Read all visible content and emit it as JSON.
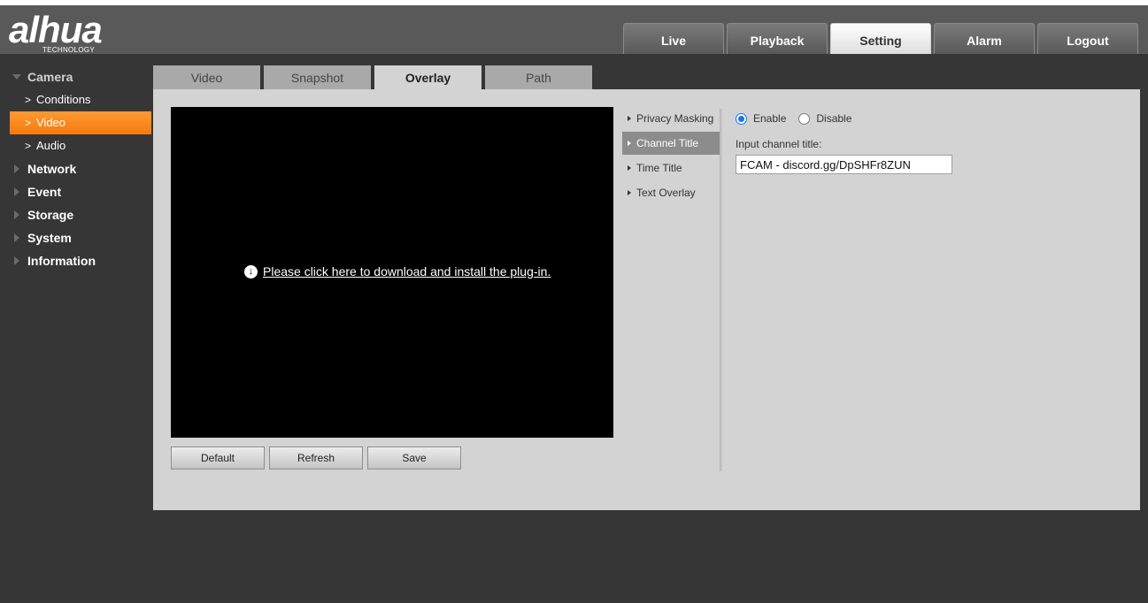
{
  "logo": {
    "main": "alhua",
    "sub": "TECHNOLOGY"
  },
  "topnav": [
    {
      "label": "Live"
    },
    {
      "label": "Playback"
    },
    {
      "label": "Setting"
    },
    {
      "label": "Alarm"
    },
    {
      "label": "Logout"
    }
  ],
  "sidebar": {
    "camera": "Camera",
    "conditions": "Conditions",
    "video": "Video",
    "audio": "Audio",
    "network": "Network",
    "event": "Event",
    "storage": "Storage",
    "system": "System",
    "information": "Information"
  },
  "tabs": [
    {
      "label": "Video"
    },
    {
      "label": "Snapshot"
    },
    {
      "label": "Overlay"
    },
    {
      "label": "Path"
    }
  ],
  "player": {
    "plugin_text": "Please click here to download and install the plug-in."
  },
  "buttons": {
    "default": "Default",
    "refresh": "Refresh",
    "save": "Save"
  },
  "submenu": [
    {
      "label": "Privacy Masking"
    },
    {
      "label": "Channel Title"
    },
    {
      "label": "Time Title"
    },
    {
      "label": "Text Overlay"
    }
  ],
  "form": {
    "enable": "Enable",
    "disable": "Disable",
    "input_label": "Input channel title:",
    "input_value": "FCAM - discord.gg/DpSHFr8ZUN"
  },
  "colors": {
    "accent": "#f57a10",
    "header": "#595959",
    "background": "#363636",
    "panel": "#d3d3d3"
  }
}
